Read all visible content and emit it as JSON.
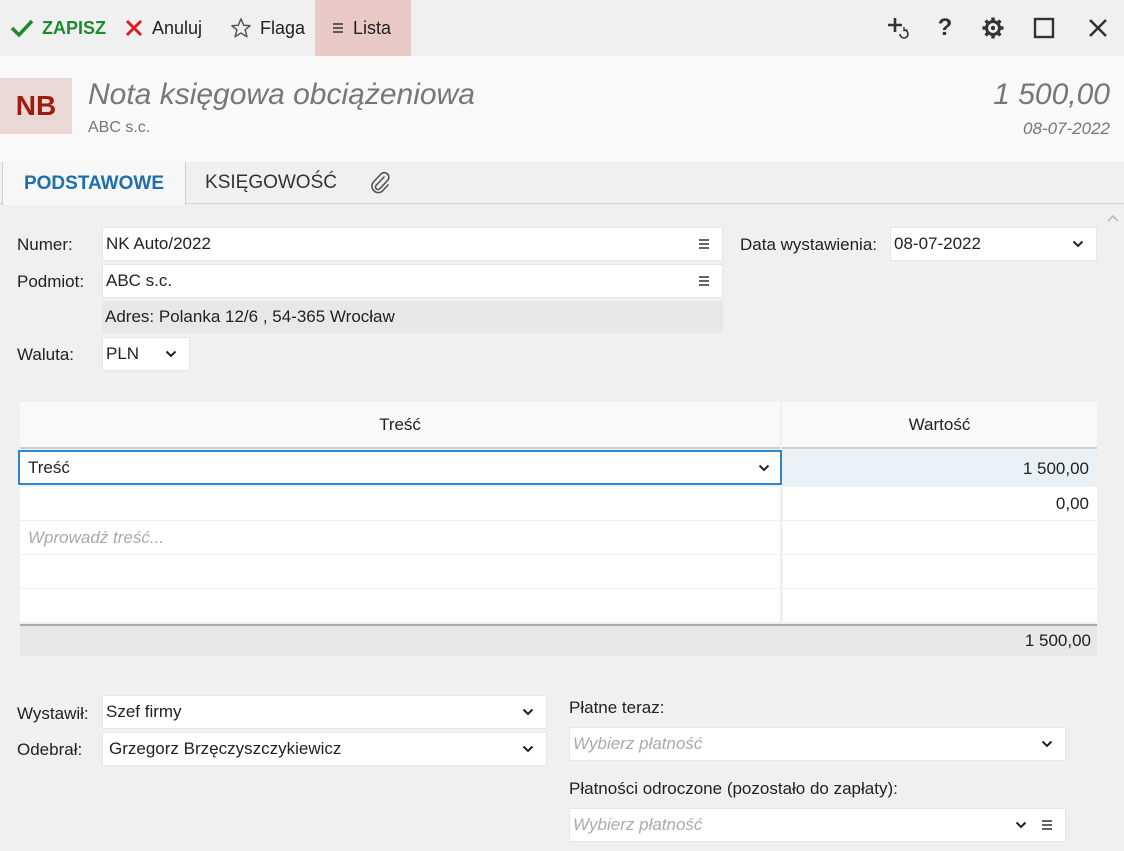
{
  "toolbar": {
    "save_label": "ZAPISZ",
    "cancel_label": "Anuluj",
    "flag_label": "Flaga",
    "list_label": "Lista",
    "colors": {
      "save": "#1e8a2e",
      "cancel": "#d32027",
      "list_bg": "#e8c9c6"
    }
  },
  "header": {
    "badge": "NB",
    "title": "Nota księgowa obciążeniowa",
    "subtitle": "ABC s.c.",
    "amount": "1 500,00",
    "date": "08-07-2022"
  },
  "tabs": [
    {
      "label": "PODSTAWOWE",
      "active": true
    },
    {
      "label": "KSIĘGOWOŚĆ",
      "active": false
    },
    {
      "icon": "paperclip-icon"
    }
  ],
  "form": {
    "numer_label": "Numer:",
    "numer_value": "NK Auto/2022",
    "data_label": "Data wystawienia:",
    "data_value": "08-07-2022",
    "podmiot_label": "Podmiot:",
    "podmiot_value": "ABC s.c.",
    "adres": "Adres:  Polanka  12/6 , 54-365 Wrocław",
    "waluta_label": "Waluta:",
    "waluta_value": "PLN"
  },
  "table": {
    "headers": [
      "Treść",
      "Wartość"
    ],
    "rows": [
      {
        "tresc": "Treść",
        "wartosc": "1 500,00"
      },
      {
        "tresc": "",
        "wartosc": "0,00"
      },
      {
        "tresc_placeholder": "Wprowadź treść...",
        "wartosc": ""
      },
      {
        "tresc": "",
        "wartosc": ""
      },
      {
        "tresc": "",
        "wartosc": ""
      }
    ],
    "total": "1 500,00"
  },
  "bottom": {
    "wystawil_label": "Wystawił:",
    "wystawil_value": "Szef firmy",
    "odebral_label": "Odebrał:",
    "odebral_value": "Grzegorz Brzęczyszczykiewicz",
    "platne_label": "Płatne teraz:",
    "platne_placeholder": "Wybierz płatność",
    "odroczone_label": "Płatności odroczone (pozostało do zapłaty):",
    "odroczone_placeholder": "Wybierz płatność"
  }
}
